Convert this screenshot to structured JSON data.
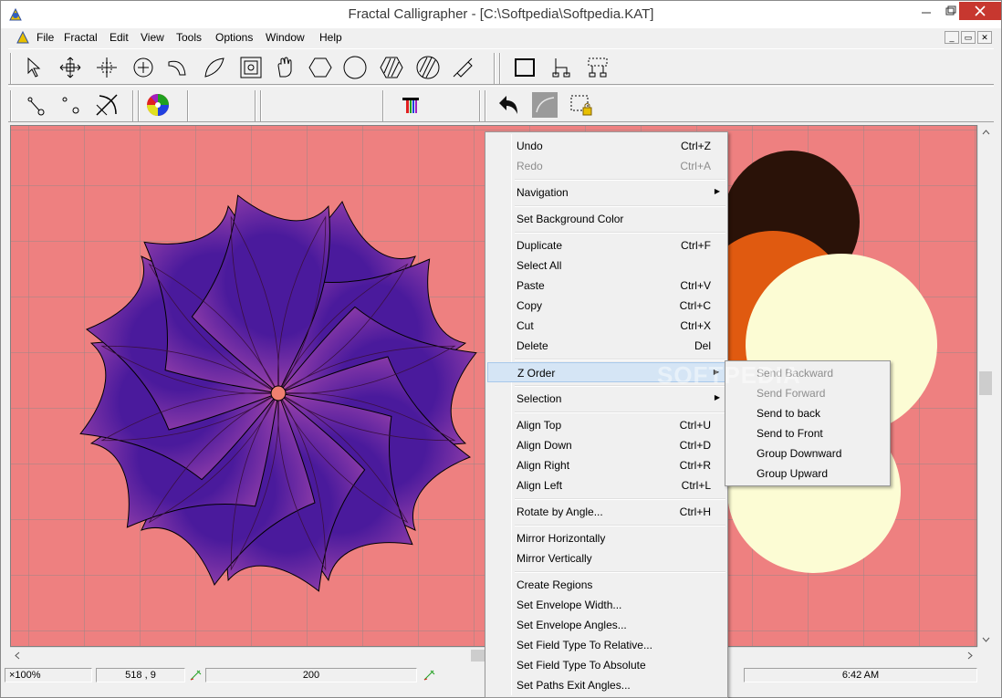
{
  "window": {
    "title": "Fractal Calligrapher - [C:\\Softpedia\\Softpedia.KAT]"
  },
  "menubar": {
    "items": [
      "File",
      "Fractal",
      "Edit",
      "View",
      "Tools",
      "Options",
      "Window",
      "Help"
    ]
  },
  "status": {
    "zoom": "×100%",
    "coords": "518 , 9",
    "value": "200",
    "time": "6:42 AM"
  },
  "watermark": "SOFTPEDIA",
  "context_menu": {
    "undo": {
      "label": "Undo",
      "shortcut": "Ctrl+Z"
    },
    "redo": {
      "label": "Redo",
      "shortcut": "Ctrl+A"
    },
    "navigation": {
      "label": "Navigation"
    },
    "set_bg": {
      "label": "Set Background Color"
    },
    "duplicate": {
      "label": "Duplicate",
      "shortcut": "Ctrl+F"
    },
    "select_all": {
      "label": "Select All"
    },
    "paste": {
      "label": "Paste",
      "shortcut": "Ctrl+V"
    },
    "copy": {
      "label": "Copy",
      "shortcut": "Ctrl+C"
    },
    "cut": {
      "label": "Cut",
      "shortcut": "Ctrl+X"
    },
    "delete": {
      "label": "Delete",
      "shortcut": "Del"
    },
    "z_order": {
      "label": "Z Order"
    },
    "selection": {
      "label": "Selection"
    },
    "align_top": {
      "label": "Align Top",
      "shortcut": "Ctrl+U"
    },
    "align_down": {
      "label": "Align Down",
      "shortcut": "Ctrl+D"
    },
    "align_right": {
      "label": "Align Right",
      "shortcut": "Ctrl+R"
    },
    "align_left": {
      "label": "Align Left",
      "shortcut": "Ctrl+L"
    },
    "rotate": {
      "label": "Rotate by Angle...",
      "shortcut": "Ctrl+H"
    },
    "mirror_h": {
      "label": "Mirror Horizontally"
    },
    "mirror_v": {
      "label": "Mirror Vertically"
    },
    "create_regions": {
      "label": "Create Regions"
    },
    "env_width": {
      "label": "Set Envelope Width..."
    },
    "env_angles": {
      "label": "Set Envelope Angles..."
    },
    "field_rel": {
      "label": "Set Field Type To Relative..."
    },
    "field_abs": {
      "label": "Set Field Type To Absolute"
    },
    "paths_exit": {
      "label": "Set Paths Exit Angles..."
    }
  },
  "submenu": {
    "send_backward": "Send Backward",
    "send_forward": "Send Forward",
    "send_to_back": "Send to back",
    "send_to_front": "Send to Front",
    "group_downward": "Group Downward",
    "group_upward": "Group Upward"
  },
  "colors": {
    "canvas": "#ee8080",
    "petal": "#4a1a9c",
    "petal_edge": "#e060a0",
    "dark": "#2a1208",
    "orange": "#e05a10",
    "cream": "#fcfcd4"
  }
}
